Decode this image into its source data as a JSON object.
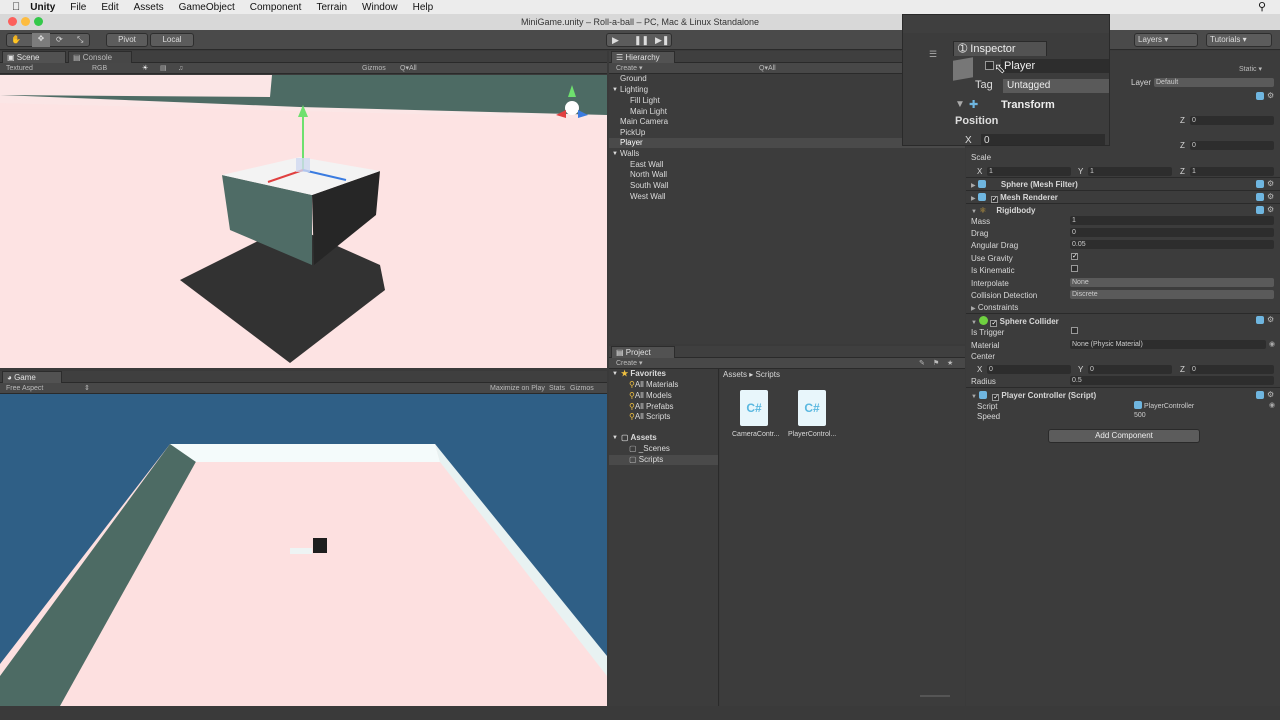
{
  "menubar": {
    "apple": "",
    "items": [
      "Unity",
      "File",
      "Edit",
      "Assets",
      "GameObject",
      "Component",
      "Terrain",
      "Window",
      "Help"
    ]
  },
  "titlebar": {
    "title": "MiniGame.unity – Roll-a-ball – PC, Mac & Linux Standalone"
  },
  "toolbar": {
    "pivot": "Pivot",
    "local": "Local",
    "layers": "Layers",
    "tutorials": "Tutorials"
  },
  "scene": {
    "tab_scene": "Scene",
    "tab_console": "Console",
    "render_mode": "Textured",
    "color_mode": "RGB",
    "gizmos": "Gizmos",
    "search": "Q▾All"
  },
  "game": {
    "tab": "Game",
    "aspect": "Free Aspect",
    "maximize": "Maximize on Play",
    "stats": "Stats",
    "gizmos": "Gizmos"
  },
  "hierarchy": {
    "tab": "Hierarchy",
    "create": "Create ▾",
    "search": "Q▾All",
    "items": [
      {
        "label": "Ground",
        "indent": 0
      },
      {
        "label": "Lighting",
        "indent": 0
      },
      {
        "label": "Fill Light",
        "indent": 1
      },
      {
        "label": "Main Light",
        "indent": 1
      },
      {
        "label": "Main Camera",
        "indent": 0
      },
      {
        "label": "PickUp",
        "indent": 0
      },
      {
        "label": "Player",
        "indent": 0
      },
      {
        "label": "Walls",
        "indent": 0
      },
      {
        "label": "East Wall",
        "indent": 1
      },
      {
        "label": "North Wall",
        "indent": 1
      },
      {
        "label": "South Wall",
        "indent": 1
      },
      {
        "label": "West Wall",
        "indent": 1
      }
    ]
  },
  "project": {
    "tab": "Project",
    "create": "Create ▾",
    "favorites": "Favorites",
    "favorite_items": [
      "All Materials",
      "All Models",
      "All Prefabs",
      "All Scripts"
    ],
    "assets": "Assets",
    "asset_folders": [
      "_Scenes",
      "Scripts"
    ],
    "breadcrumb_root": "Assets",
    "breadcrumb_sep": "▸",
    "breadcrumb_current": "Scripts",
    "files": [
      "CameraContr...",
      "PlayerControl..."
    ]
  },
  "inspector": {
    "tab": "Inspector",
    "object_name": "Player",
    "static": "Static ▾",
    "tag_label": "Tag",
    "tag_value": "Untagged",
    "layer_label": "Layer",
    "layer_value": "Default",
    "transform": "Transform",
    "position": "Position",
    "pos_x_label": "X",
    "pos_x": "0",
    "z_label": "Z",
    "rot_z": "0",
    "rot_z2": "0",
    "scale": "Scale",
    "scale_x_label": "X",
    "scale_x": "1",
    "scale_y_label": "Y",
    "scale_y": "1",
    "scale_z_label": "Z",
    "scale_z": "1",
    "mesh_filter": "Sphere (Mesh Filter)",
    "mesh_renderer": "Mesh Renderer",
    "rigidbody": "Rigidbody",
    "mass_label": "Mass",
    "mass": "1",
    "drag_label": "Drag",
    "drag": "0",
    "angular_drag_label": "Angular Drag",
    "angular_drag": "0.05",
    "use_gravity_label": "Use Gravity",
    "use_gravity": "✓",
    "is_kinematic_label": "Is Kinematic",
    "interpolate_label": "Interpolate",
    "interpolate": "None",
    "collision_label": "Collision Detection",
    "collision": "Discrete",
    "constraints_label": "Constraints",
    "sphere_collider": "Sphere Collider",
    "is_trigger_label": "Is Trigger",
    "material_label": "Material",
    "material": "None (Physic Material)",
    "center_label": "Center",
    "center_x_label": "X",
    "center_x": "0",
    "center_y_label": "Y",
    "center_y": "0",
    "center_z_label": "Z",
    "center_z": "0",
    "radius_label": "Radius",
    "radius": "0.5",
    "player_controller": "Player Controller (Script)",
    "script_label": "Script",
    "script": "PlayerController",
    "speed_label": "Speed",
    "speed": "500",
    "add_component": "Add Component"
  },
  "colors": {
    "scene_bg": "#fbe6e6",
    "game_sky": "#2f5f86",
    "floor": "#ffe0e0",
    "wall": "#4d6b64",
    "selection": "#3d5f8a"
  }
}
